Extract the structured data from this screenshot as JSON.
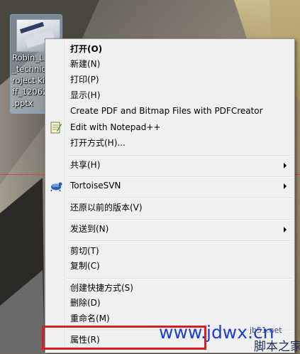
{
  "desktop_file": {
    "name_lines": [
      "Robin_L",
      "_technica",
      "roject ki",
      "ff_12062",
      ".pptx"
    ]
  },
  "context_menu": {
    "items": [
      {
        "label": "打开(O)",
        "bold": true
      },
      {
        "label": "新建(N)"
      },
      {
        "label": "打印(P)"
      },
      {
        "label": "显示(H)"
      },
      {
        "label": "Create PDF and Bitmap Files with PDFCreator"
      },
      {
        "label": "Edit with Notepad++",
        "icon": "notepad-plus-plus-icon"
      },
      {
        "label": "打开方式(H)..."
      },
      {
        "label": "共享(H)",
        "submenu": true
      },
      {
        "label": "TortoiseSVN",
        "icon": "tortoisesvn-icon",
        "submenu": true
      },
      {
        "label": "还原以前的版本(V)"
      },
      {
        "label": "发送到(N)",
        "submenu": true
      },
      {
        "label": "剪切(T)"
      },
      {
        "label": "复制(C)"
      },
      {
        "label": "创建快捷方式(S)"
      },
      {
        "label": "删除(D)"
      },
      {
        "label": "重命名(M)"
      },
      {
        "label": "属性(R)",
        "highlighted": true
      }
    ]
  },
  "watermark": {
    "url": "www.jdwx.cn",
    "site_name": "脚本之家",
    "small": "jb51.net"
  },
  "colors": {
    "menu_bg": "#f0f0f0",
    "highlight_border": "#d42020",
    "watermark_blue": "#1a3fd0"
  }
}
